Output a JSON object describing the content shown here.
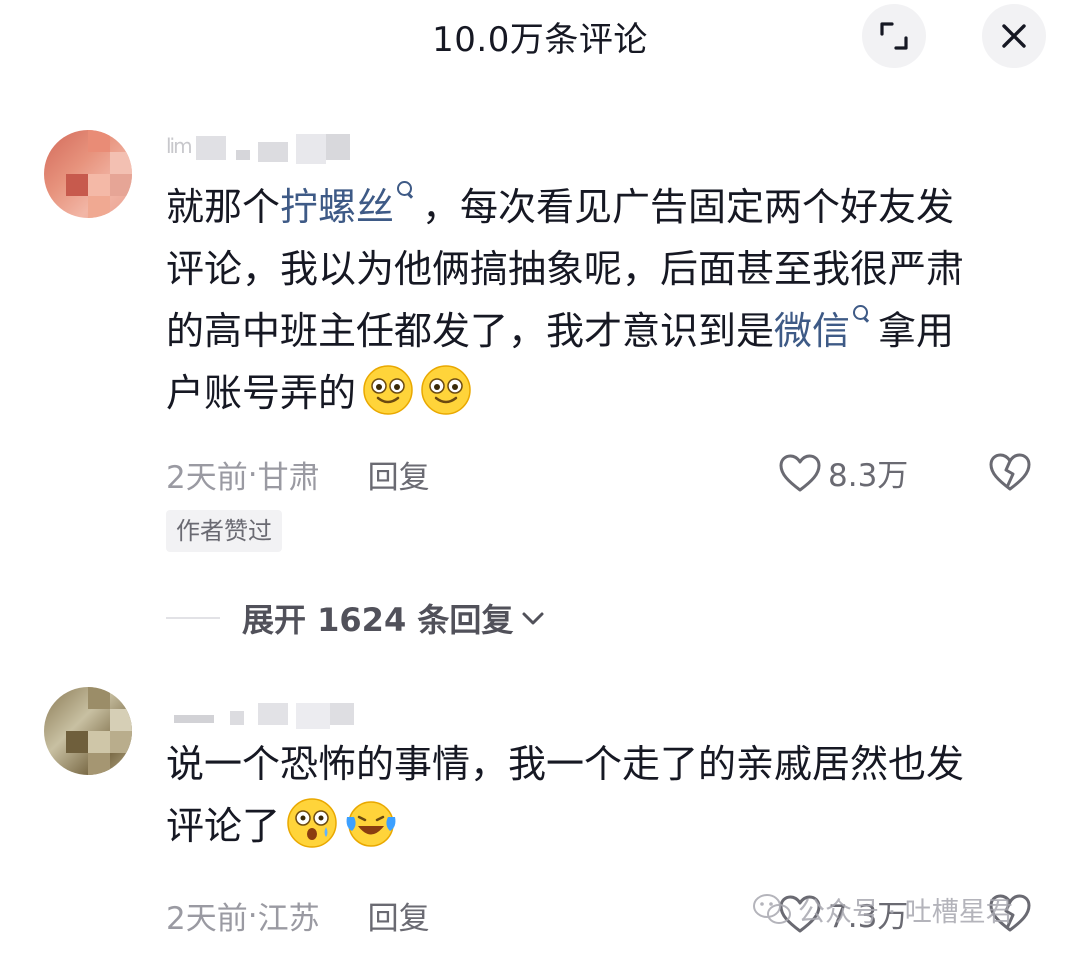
{
  "header": {
    "title": "10.0万条评论",
    "expand_icon": "expand-icon",
    "close_icon": "close-icon"
  },
  "comments": [
    {
      "username": "lim",
      "segments": {
        "l1a": "就那个",
        "l1_link": "拧螺丝",
        "l1b": "，每次看见广告固定两个好友发",
        "l2": "评论，我以为他俩搞抽象呢，后面甚至我很严肃",
        "l3a": "的高中班主任都发了，我才意识到是",
        "l3_link": "微信",
        "l3b": "拿用",
        "l4": "户账号弄的"
      },
      "time": "2天前",
      "sep": " · ",
      "location": "甘肃",
      "reply": "回复",
      "likes": "8.3万",
      "badge": "作者赞过"
    },
    {
      "username": "",
      "segments": {
        "l1": "说一个恐怖的事情，我一个走了的亲戚居然也发",
        "l2": "评论了"
      },
      "time": "2天前",
      "sep": " · ",
      "location": "江苏",
      "reply": "回复",
      "likes": "7.3万"
    }
  ],
  "expand_replies": "展开 1624 条回复",
  "watermark": "公众号 · 吐槽星君",
  "colors": {
    "link": "#3e5a86",
    "secondary_text": "#9a9aa2",
    "primary_text": "#161823"
  }
}
